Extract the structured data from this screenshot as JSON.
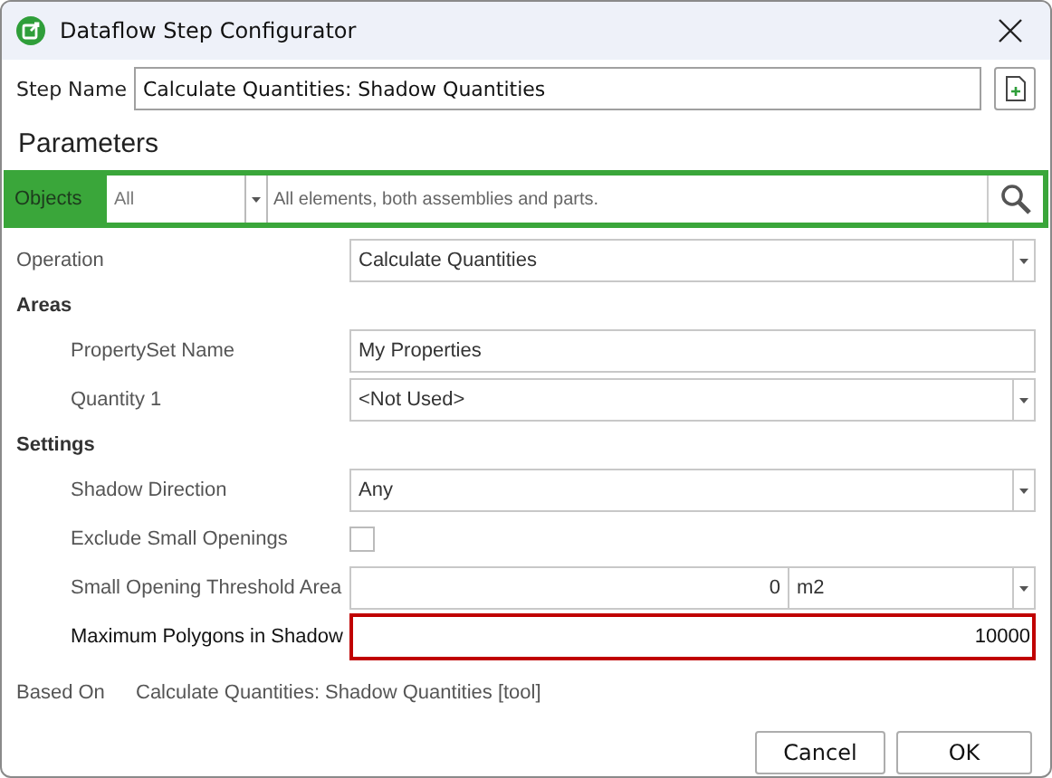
{
  "window": {
    "title": "Dataflow Step Configurator"
  },
  "step_name": {
    "label": "Step Name",
    "value": "Calculate Quantities: Shadow Quantities"
  },
  "section_title": "Parameters",
  "objects": {
    "label": "Objects",
    "scope": "All",
    "description": "All elements, both assemblies and parts."
  },
  "rows": [
    {
      "kind": "dropdown",
      "label": "Operation",
      "value": "Calculate Quantities",
      "indented": false
    },
    {
      "kind": "heading",
      "label": "Areas"
    },
    {
      "kind": "text",
      "label": "PropertySet Name",
      "value": "My Properties",
      "indented": true
    },
    {
      "kind": "dropdown",
      "label": "Quantity 1",
      "value": "<Not Used>",
      "indented": true
    },
    {
      "kind": "heading",
      "label": "Settings"
    },
    {
      "kind": "dropdown",
      "label": "Shadow Direction",
      "value": "Any",
      "indented": true
    },
    {
      "kind": "checkbox",
      "label": "Exclude Small Openings",
      "checked": false,
      "indented": true
    },
    {
      "kind": "number_unit",
      "label": "Small Opening Threshold Area",
      "value": "0",
      "unit": "m2",
      "indented": true
    },
    {
      "kind": "number",
      "label": "Maximum Polygons in Shadow",
      "value": "10000",
      "indented": true,
      "error": true
    }
  ],
  "based_on": {
    "label": "Based On",
    "value": "Calculate Quantities: Shadow Quantities [tool]"
  },
  "buttons": [
    "Cancel",
    "OK"
  ]
}
